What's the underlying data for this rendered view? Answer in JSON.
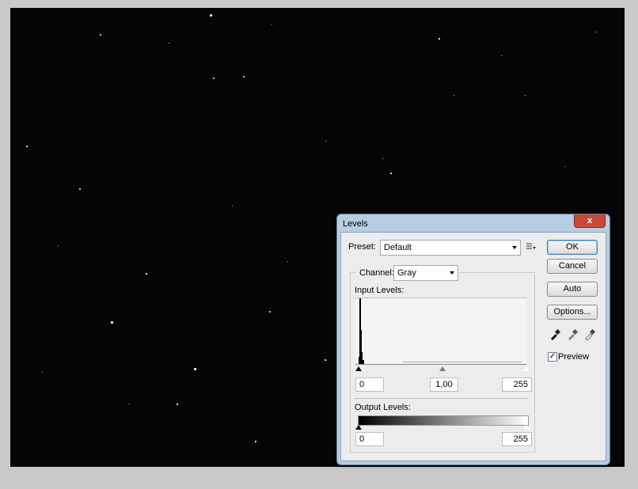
{
  "dialog": {
    "title": "Levels",
    "close_label": "x",
    "preset_label": "Preset:",
    "preset_value": "Default",
    "channel_label": "Channel:",
    "channel_value": "Gray",
    "input_levels_label": "Input Levels:",
    "input_black": "0",
    "input_gamma": "1,00",
    "input_white": "255",
    "output_levels_label": "Output Levels:",
    "output_black": "0",
    "output_white": "255",
    "buttons": {
      "ok": "OK",
      "cancel": "Cancel",
      "auto": "Auto",
      "options": "Options..."
    },
    "preview_label": "Preview",
    "preview_checked": true
  },
  "icons": [
    "presets-menu-icon",
    "black-eyedropper-icon",
    "gray-eyedropper-icon",
    "white-eyedropper-icon",
    "close-icon"
  ]
}
